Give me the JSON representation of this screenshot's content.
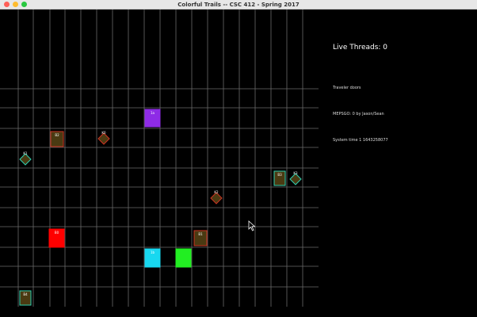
{
  "window": {
    "title": "Colorful Trails -- CSC 412 - Spring 2017"
  },
  "sidebar": {
    "live_threads": "Live Threads: 0",
    "line1": "Traveler doors",
    "line2": "MEPSGO: 0 by Jason/Sean",
    "line3": "System time 1 1643258077"
  },
  "board": {
    "grid_color": "#6a6a6a",
    "squares": [
      {
        "label": "1a",
        "fill": "#8e2be6",
        "border": "#8e2be6",
        "name": "traveler-head-purple"
      },
      {
        "label": "B2",
        "fill": "#4a3a12",
        "border": "#cc3322",
        "name": "door-b2"
      },
      {
        "label": "B0",
        "fill": "#ff0000",
        "border": "#ff0000",
        "name": "traveler-head-red"
      },
      {
        "label": "B1",
        "fill": "#4a3a12",
        "border": "#cc3322",
        "name": "door-b1"
      },
      {
        "label": "1b",
        "fill": "#18d8f0",
        "border": "#18d8f0",
        "name": "traveler-head-cyan"
      },
      {
        "label": "",
        "fill": "#22ee22",
        "border": "#22ee22",
        "name": "traveler-head-green"
      },
      {
        "label": "B3",
        "fill": "#4a3a12",
        "border": "#2fd0b0",
        "name": "door-b3"
      },
      {
        "label": "B4",
        "fill": "#4a3a12",
        "border": "#2fd0b0",
        "name": "door-b4"
      }
    ],
    "diamonds": [
      {
        "label": "K0",
        "fill": "#4a3a12",
        "border": "#cc3322",
        "name": "key-k0"
      },
      {
        "label": "K1",
        "fill": "#4a3a12",
        "border": "#2fd0b0",
        "name": "key-k1"
      },
      {
        "label": "K2",
        "fill": "#4a3a12",
        "border": "#cc3322",
        "name": "key-k2"
      },
      {
        "label": "K3",
        "fill": "#4a3a12",
        "border": "#2fd0b0",
        "name": "key-k3"
      }
    ]
  }
}
